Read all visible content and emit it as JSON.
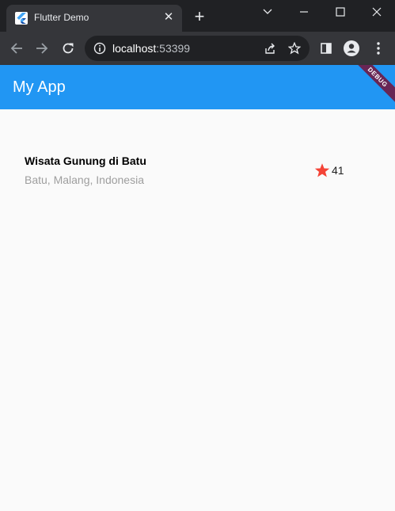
{
  "browser": {
    "tab_title": "Flutter Demo",
    "url_host": "localhost",
    "url_port": ":53399"
  },
  "app": {
    "title": "My App",
    "debug_banner": "DEBUG",
    "colors": {
      "primary": "#2196f3",
      "star": "#f44336"
    }
  },
  "place": {
    "name": "Wisata Gunung di Batu",
    "location": "Batu, Malang, Indonesia",
    "rating": "41",
    "rating_icon": "star-icon"
  }
}
